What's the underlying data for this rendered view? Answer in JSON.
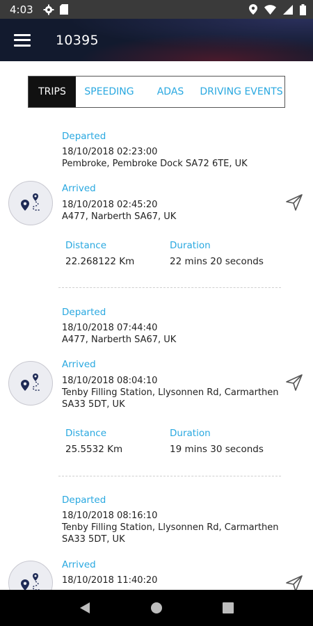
{
  "status_bar": {
    "time": "4:03"
  },
  "app_bar": {
    "title": "10395"
  },
  "tabs": [
    {
      "label": "TRIPS",
      "active": true
    },
    {
      "label": "SPEEDING",
      "active": false
    },
    {
      "label": "ADAS",
      "active": false
    },
    {
      "label": "DRIVING EVENTS",
      "active": false
    }
  ],
  "labels": {
    "departed": "Departed",
    "arrived": "Arrived",
    "distance": "Distance",
    "duration": "Duration"
  },
  "trips": [
    {
      "departed_time": "18/10/2018 02:23:00",
      "departed_address": "Pembroke, Pembroke Dock SA72 6TE, UK",
      "arrived_time": "18/10/2018 02:45:20",
      "arrived_address": "A477, Narberth SA67, UK",
      "distance": "22.268122 Km",
      "duration": "22 mins 20 seconds"
    },
    {
      "departed_time": "18/10/2018 07:44:40",
      "departed_address": "A477, Narberth SA67, UK",
      "arrived_time": "18/10/2018 08:04:10",
      "arrived_address_line1": "Tenby Filling Station, Llysonnen Rd, Carmarthen",
      "arrived_address_line2": "SA33 5DT, UK",
      "distance": "25.5532 Km",
      "duration": "19 mins 30 seconds"
    },
    {
      "departed_time": "18/10/2018 08:16:10",
      "departed_address_line1": "Tenby Filling Station, Llysonnen Rd, Carmarthen",
      "departed_address_line2": "SA33 5DT, UK",
      "arrived_time": "18/10/2018 11:40:20"
    }
  ],
  "icons": {
    "menu": "hamburger-menu-icon",
    "avatar": "route-pins-icon",
    "send": "send-icon"
  },
  "colors": {
    "accent": "#29a8e0",
    "active_tab_bg": "#111111",
    "status_bar_bg": "#3a3a3a"
  }
}
